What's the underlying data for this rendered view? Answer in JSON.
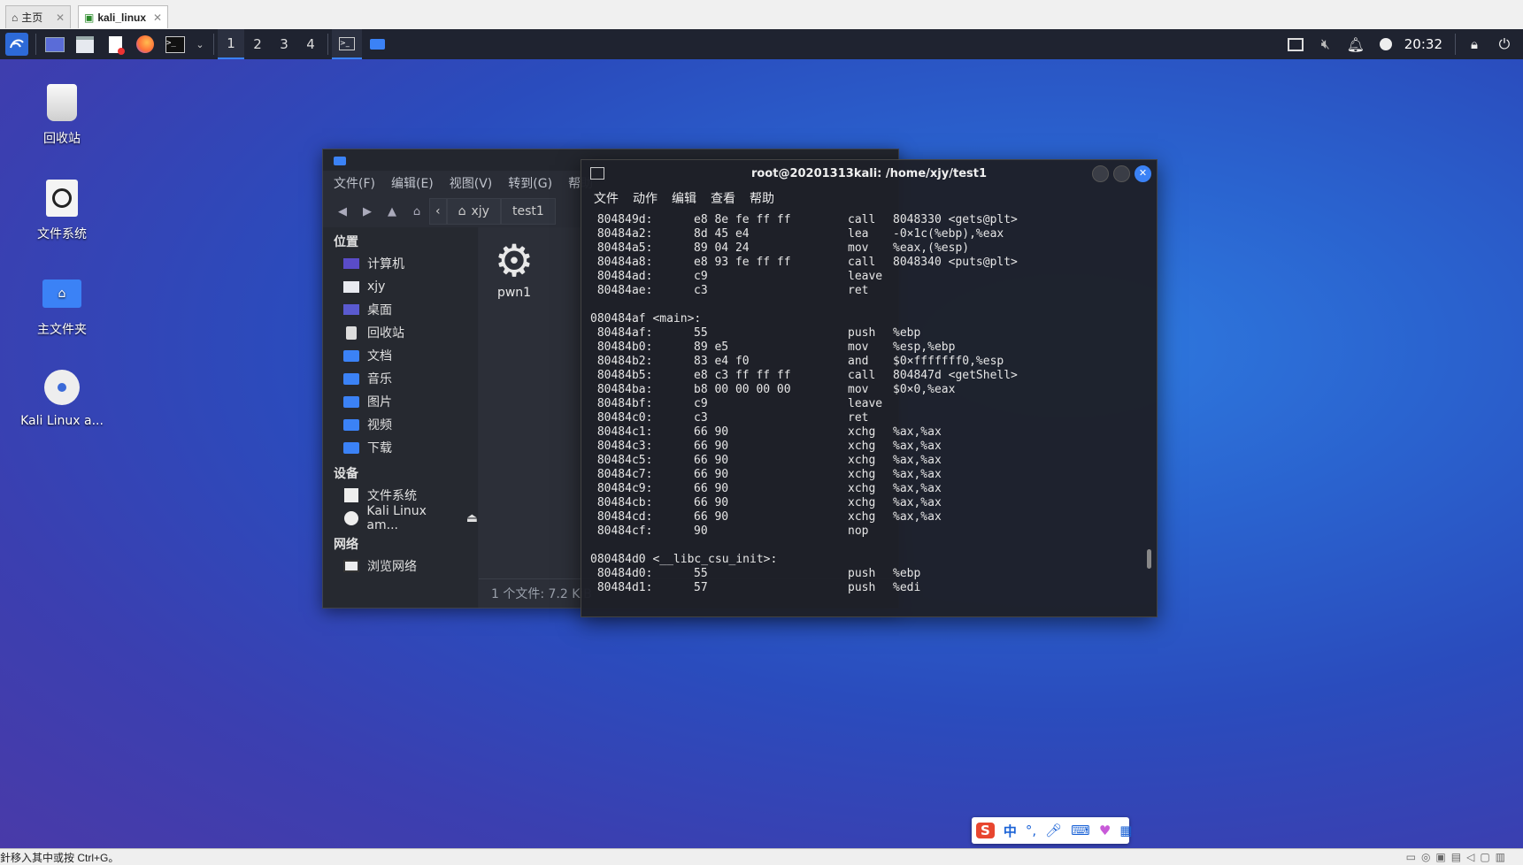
{
  "vm_tabs": {
    "home_label": "主页",
    "vm_label": "kali_linux"
  },
  "panel": {
    "workspaces": [
      "1",
      "2",
      "3",
      "4"
    ],
    "clock": "20:32"
  },
  "desktop_icons": [
    {
      "label": "回收站"
    },
    {
      "label": "文件系统"
    },
    {
      "label": "主文件夹"
    },
    {
      "label": "Kali Linux a..."
    }
  ],
  "file_manager": {
    "menu": [
      "文件(F)",
      "编辑(E)",
      "视图(V)",
      "转到(G)",
      "帮助"
    ],
    "breadcrumb": [
      "xjy",
      "test1"
    ],
    "sections": {
      "places": "位置",
      "places_items": [
        "计算机",
        "xjy",
        "桌面",
        "回收站",
        "文档",
        "音乐",
        "图片",
        "视频",
        "下载"
      ],
      "devices": "设备",
      "devices_items": [
        "文件系统",
        "Kali Linux am..."
      ],
      "network": "网络",
      "network_items": [
        "浏览网络"
      ]
    },
    "file_name": "pwn1",
    "status": "1 个文件: 7.2 KiB"
  },
  "terminal": {
    "title": "root@20201313kali: /home/xjy/test1",
    "menu": [
      "文件",
      "动作",
      "编辑",
      "查看",
      "帮助"
    ],
    "lines": [
      {
        "addr": " 804849d:",
        "bytes": "e8 8e fe ff ff",
        "op": "call",
        "arg": "8048330 <gets@plt>"
      },
      {
        "addr": " 80484a2:",
        "bytes": "8d 45 e4",
        "op": "lea",
        "arg": "-0×1c(%ebp),%eax"
      },
      {
        "addr": " 80484a5:",
        "bytes": "89 04 24",
        "op": "mov",
        "arg": "%eax,(%esp)"
      },
      {
        "addr": " 80484a8:",
        "bytes": "e8 93 fe ff ff",
        "op": "call",
        "arg": "8048340 <puts@plt>"
      },
      {
        "addr": " 80484ad:",
        "bytes": "c9",
        "op": "leave",
        "arg": ""
      },
      {
        "addr": " 80484ae:",
        "bytes": "c3",
        "op": "ret",
        "arg": ""
      },
      {
        "addr": "",
        "bytes": "",
        "op": "",
        "arg": ""
      },
      {
        "addr": "080484af <main>:",
        "bytes": "",
        "op": "",
        "arg": ""
      },
      {
        "addr": " 80484af:",
        "bytes": "55",
        "op": "push",
        "arg": "%ebp"
      },
      {
        "addr": " 80484b0:",
        "bytes": "89 e5",
        "op": "mov",
        "arg": "%esp,%ebp"
      },
      {
        "addr": " 80484b2:",
        "bytes": "83 e4 f0",
        "op": "and",
        "arg": "$0×fffffff0,%esp"
      },
      {
        "addr": " 80484b5:",
        "bytes": "e8 c3 ff ff ff",
        "op": "call",
        "arg": "804847d <getShell>"
      },
      {
        "addr": " 80484ba:",
        "bytes": "b8 00 00 00 00",
        "op": "mov",
        "arg": "$0×0,%eax"
      },
      {
        "addr": " 80484bf:",
        "bytes": "c9",
        "op": "leave",
        "arg": ""
      },
      {
        "addr": " 80484c0:",
        "bytes": "c3",
        "op": "ret",
        "arg": ""
      },
      {
        "addr": " 80484c1:",
        "bytes": "66 90",
        "op": "xchg",
        "arg": "%ax,%ax"
      },
      {
        "addr": " 80484c3:",
        "bytes": "66 90",
        "op": "xchg",
        "arg": "%ax,%ax"
      },
      {
        "addr": " 80484c5:",
        "bytes": "66 90",
        "op": "xchg",
        "arg": "%ax,%ax"
      },
      {
        "addr": " 80484c7:",
        "bytes": "66 90",
        "op": "xchg",
        "arg": "%ax,%ax"
      },
      {
        "addr": " 80484c9:",
        "bytes": "66 90",
        "op": "xchg",
        "arg": "%ax,%ax"
      },
      {
        "addr": " 80484cb:",
        "bytes": "66 90",
        "op": "xchg",
        "arg": "%ax,%ax"
      },
      {
        "addr": " 80484cd:",
        "bytes": "66 90",
        "op": "xchg",
        "arg": "%ax,%ax"
      },
      {
        "addr": " 80484cf:",
        "bytes": "90",
        "op": "nop",
        "arg": ""
      },
      {
        "addr": "",
        "bytes": "",
        "op": "",
        "arg": ""
      },
      {
        "addr": "080484d0 <__libc_csu_init>:",
        "bytes": "",
        "op": "",
        "arg": ""
      },
      {
        "addr": " 80484d0:",
        "bytes": "55",
        "op": "push",
        "arg": "%ebp"
      },
      {
        "addr": " 80484d1:",
        "bytes": "57",
        "op": "push",
        "arg": "%edi"
      }
    ]
  },
  "host_status": "針移入其中或按 Ctrl+G。",
  "ime": {
    "mode": "中"
  }
}
